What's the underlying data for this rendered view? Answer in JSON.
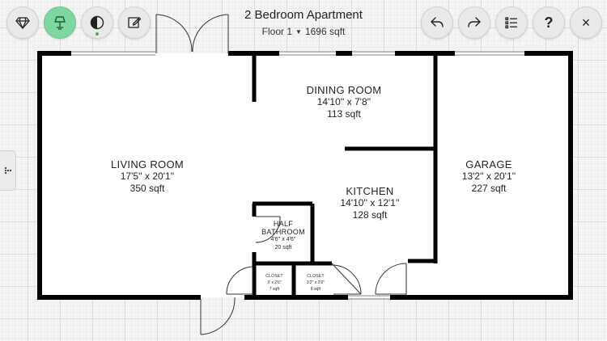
{
  "header": {
    "title": "2 Bedroom Apartment",
    "floor": "Floor 1",
    "area": "1696 sqft"
  },
  "toolbar": {
    "left": [
      {
        "icon": "diamond-icon"
      },
      {
        "icon": "lamp-icon",
        "active": true
      },
      {
        "icon": "contrast-icon",
        "indicator": "#4caf50"
      },
      {
        "icon": "edit-icon"
      }
    ],
    "right": [
      {
        "icon": "undo-icon"
      },
      {
        "icon": "redo-icon"
      },
      {
        "icon": "list-icon"
      },
      {
        "label": "?"
      },
      {
        "label": "×"
      }
    ]
  },
  "rooms": {
    "living": {
      "name": "LIVING ROOM",
      "dim": "17'5'' x 20'1''",
      "area": "350 sqft"
    },
    "dining": {
      "name": "DINING ROOM",
      "dim": "14'10'' x 7'8''",
      "area": "113 sqft"
    },
    "kitchen": {
      "name": "KITCHEN",
      "dim": "14'10'' x 12'1''",
      "area": "128 sqft"
    },
    "garage": {
      "name": "GARAGE",
      "dim": "13'2'' x 20'1''",
      "area": "227 sqft"
    },
    "half_bath": {
      "name_line1": "HALF",
      "name_line2": "BATHROOM",
      "dim": "4'6'' x 4'6''",
      "area": "20 sqft"
    },
    "closet_left": {
      "name": "CLOSET",
      "dim": "3' x 2'6''",
      "area": "7 sqft"
    },
    "closet_right": {
      "name": "CLOSET",
      "dim": "3'2'' x 2'6''",
      "area": "8 sqft"
    }
  },
  "colors": {
    "wall": "#000000",
    "accent_green": "#7ed6a1",
    "indicator_green": "#4caf50"
  }
}
